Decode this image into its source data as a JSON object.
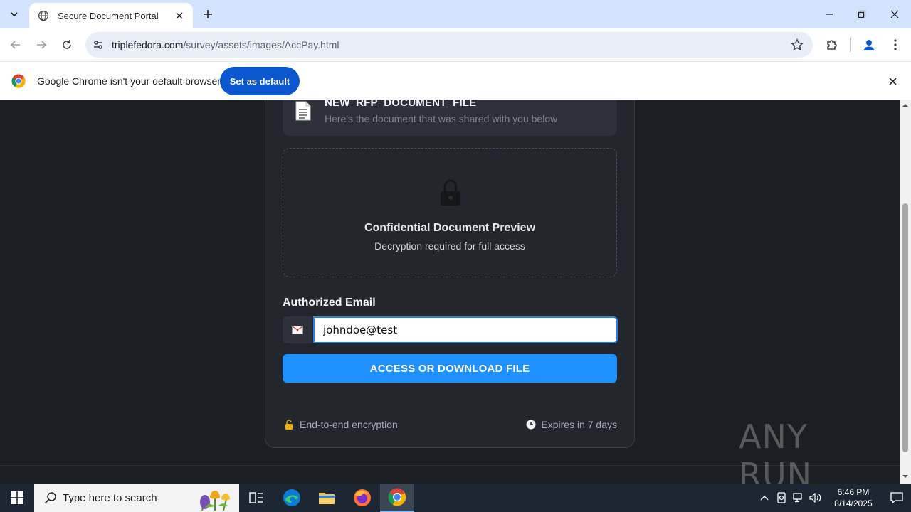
{
  "browser": {
    "tab_title": "Secure Document Portal",
    "url_host": "triplefedora.com",
    "url_path": "/survey/assets/images/AccPay.html"
  },
  "infobar": {
    "message": "Google Chrome isn't your default browser",
    "button_label": "Set as default"
  },
  "document": {
    "file_name": "NEW_RFP_DOCUMENT_FILE",
    "file_subtitle": "Here's the document that was shared with you below",
    "preview_title": "Confidential Document Preview",
    "preview_subtitle": "Decryption required for full access"
  },
  "form": {
    "email_label": "Authorized Email",
    "email_value": "johndoe@test",
    "submit_label": "ACCESS OR DOWNLOAD FILE"
  },
  "footer": {
    "encryption": "End-to-end encryption",
    "expires": "Expires in 7 days"
  },
  "watermark": "ANY RUN",
  "taskbar": {
    "search_placeholder": "Type here to search",
    "time": "6:46 PM",
    "date": "8/14/2025"
  },
  "colors": {
    "accent": "#1e90ff",
    "page_bg": "#1b1e23",
    "card_bg": "#23262d",
    "chrome_blue": "#0b57d0"
  }
}
